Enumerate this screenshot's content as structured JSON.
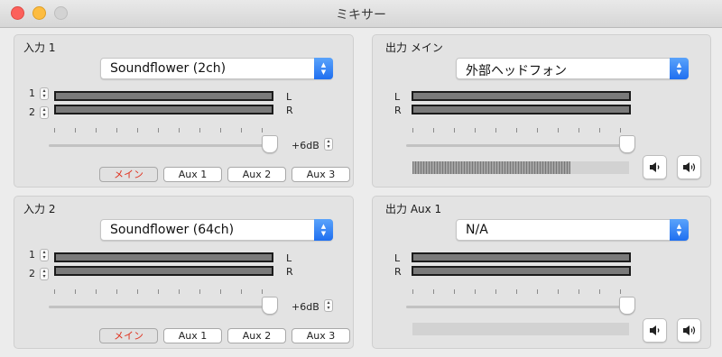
{
  "window": {
    "title": "ミキサー"
  },
  "inputs": [
    {
      "title": "入力 1",
      "device": "Soundflower (2ch)",
      "channels": [
        "1",
        "2"
      ],
      "meters": [
        "L",
        "R"
      ],
      "gain": "+6dB",
      "routes": [
        "メイン",
        "Aux 1",
        "Aux 2",
        "Aux 3"
      ],
      "active_route": 0
    },
    {
      "title": "入力 2",
      "device": "Soundflower (64ch)",
      "channels": [
        "1",
        "2"
      ],
      "meters": [
        "L",
        "R"
      ],
      "gain": "+6dB",
      "routes": [
        "メイン",
        "Aux 1",
        "Aux 2",
        "Aux 3"
      ],
      "active_route": 0
    }
  ],
  "outputs": [
    {
      "title": "出力 メイン",
      "device": "外部ヘッドフォン",
      "meters": [
        "L",
        "R"
      ],
      "level": 0.73,
      "buttons": [
        "volume-down-icon",
        "volume-up-icon"
      ]
    },
    {
      "title": "出力 Aux 1",
      "device": "N/A",
      "meters": [
        "L",
        "R"
      ],
      "level": 0,
      "buttons": [
        "volume-down-icon",
        "volume-up-icon"
      ]
    }
  ],
  "colors": {
    "active_route_text": "#e0321f",
    "popup_accent": "#1f6ff0"
  }
}
